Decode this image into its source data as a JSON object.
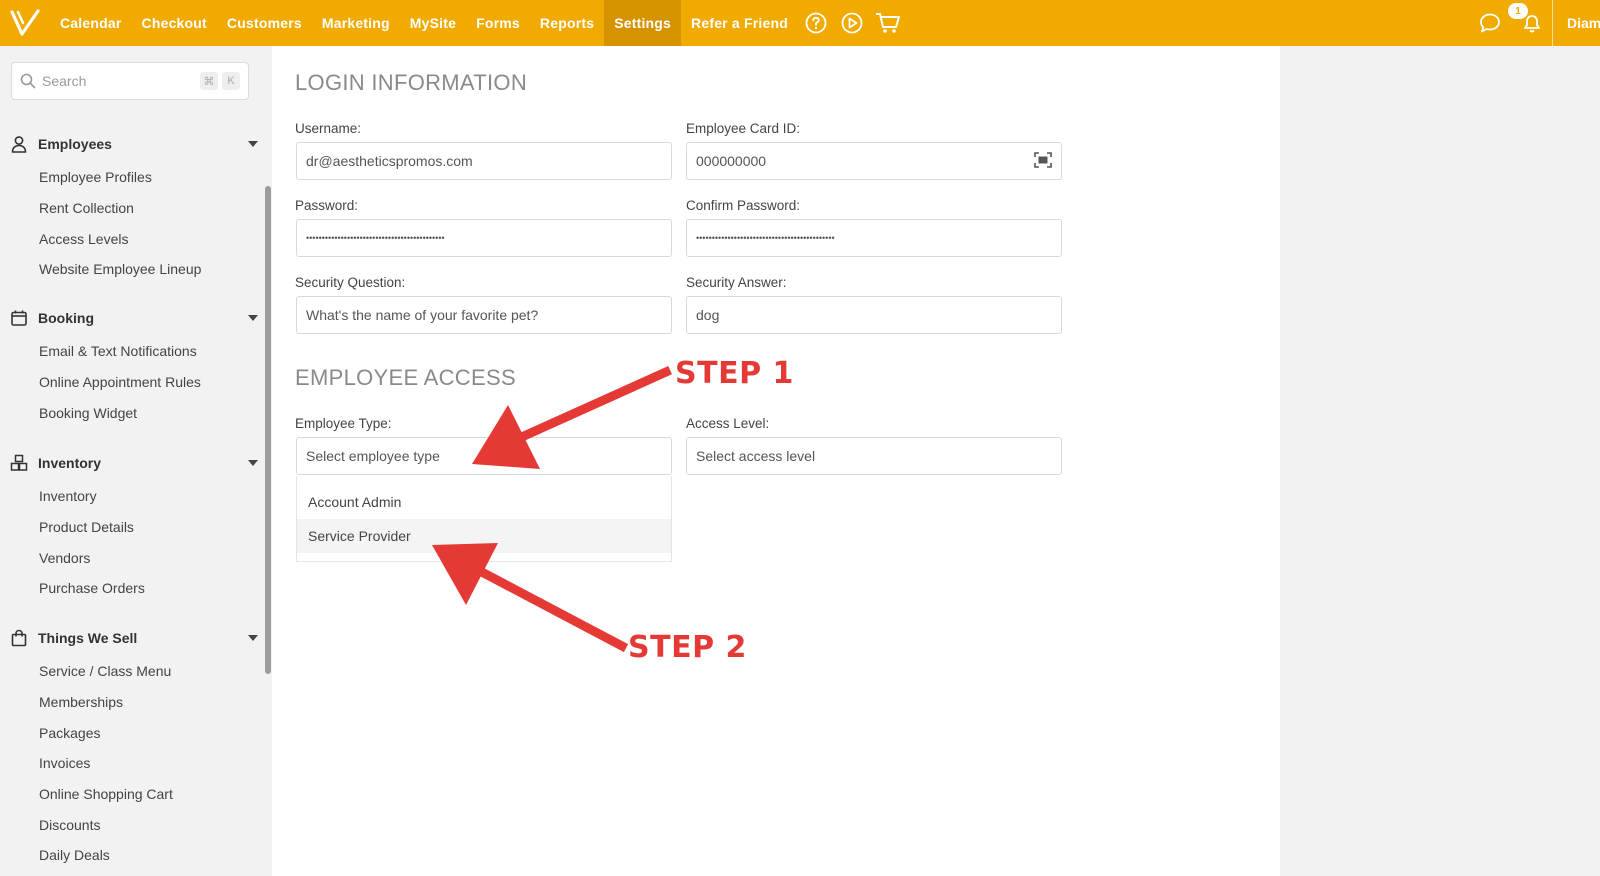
{
  "nav": {
    "items": [
      "Calendar",
      "Checkout",
      "Customers",
      "Marketing",
      "MySite",
      "Forms",
      "Reports",
      "Settings",
      "Refer a Friend"
    ],
    "active": "Settings",
    "notification_count": "1",
    "user_name": "Diamo"
  },
  "search": {
    "placeholder": "Search",
    "shortcut_cmd": "⌘",
    "shortcut_key": "K"
  },
  "sidebar": {
    "sections": [
      {
        "title": "Employees",
        "icon": "person-icon",
        "items": [
          "Employee Profiles",
          "Rent Collection",
          "Access Levels",
          "Website Employee Lineup"
        ]
      },
      {
        "title": "Booking",
        "icon": "calendar-icon",
        "items": [
          "Email & Text Notifications",
          "Online Appointment Rules",
          "Booking Widget"
        ]
      },
      {
        "title": "Inventory",
        "icon": "boxes-icon",
        "items": [
          "Inventory",
          "Product Details",
          "Vendors",
          "Purchase Orders"
        ]
      },
      {
        "title": "Things We Sell",
        "icon": "shopping-bag-icon",
        "items": [
          "Service / Class Menu",
          "Memberships",
          "Packages",
          "Invoices",
          "Online Shopping Cart",
          "Discounts",
          "Daily Deals"
        ]
      }
    ]
  },
  "login": {
    "heading": "LOGIN INFORMATION",
    "username_label": "Username:",
    "username_value": "dr@aestheticspromos.com",
    "card_label": "Employee Card ID:",
    "card_value": "000000000",
    "password_label": "Password:",
    "password_value": "••••••••••••••••••••••••••••••••••••••••••••",
    "confirm_label": "Confirm Password:",
    "confirm_value": "••••••••••••••••••••••••••••••••••••••••••••",
    "question_label": "Security Question:",
    "question_value": "What's the name of your favorite pet?",
    "answer_label": "Security Answer:",
    "answer_value": "dog"
  },
  "access": {
    "heading": "EMPLOYEE ACCESS",
    "type_label": "Employee Type:",
    "type_placeholder": "Select employee type",
    "type_options": [
      "Account Admin",
      "Service Provider"
    ],
    "level_label": "Access Level:",
    "level_placeholder": "Select access level"
  },
  "annotations": {
    "step1": "STEP 1",
    "step2": "STEP 2",
    "color": "#e53935"
  },
  "colors": {
    "brand": "#f0aa00",
    "active_nav": "#d59300"
  }
}
